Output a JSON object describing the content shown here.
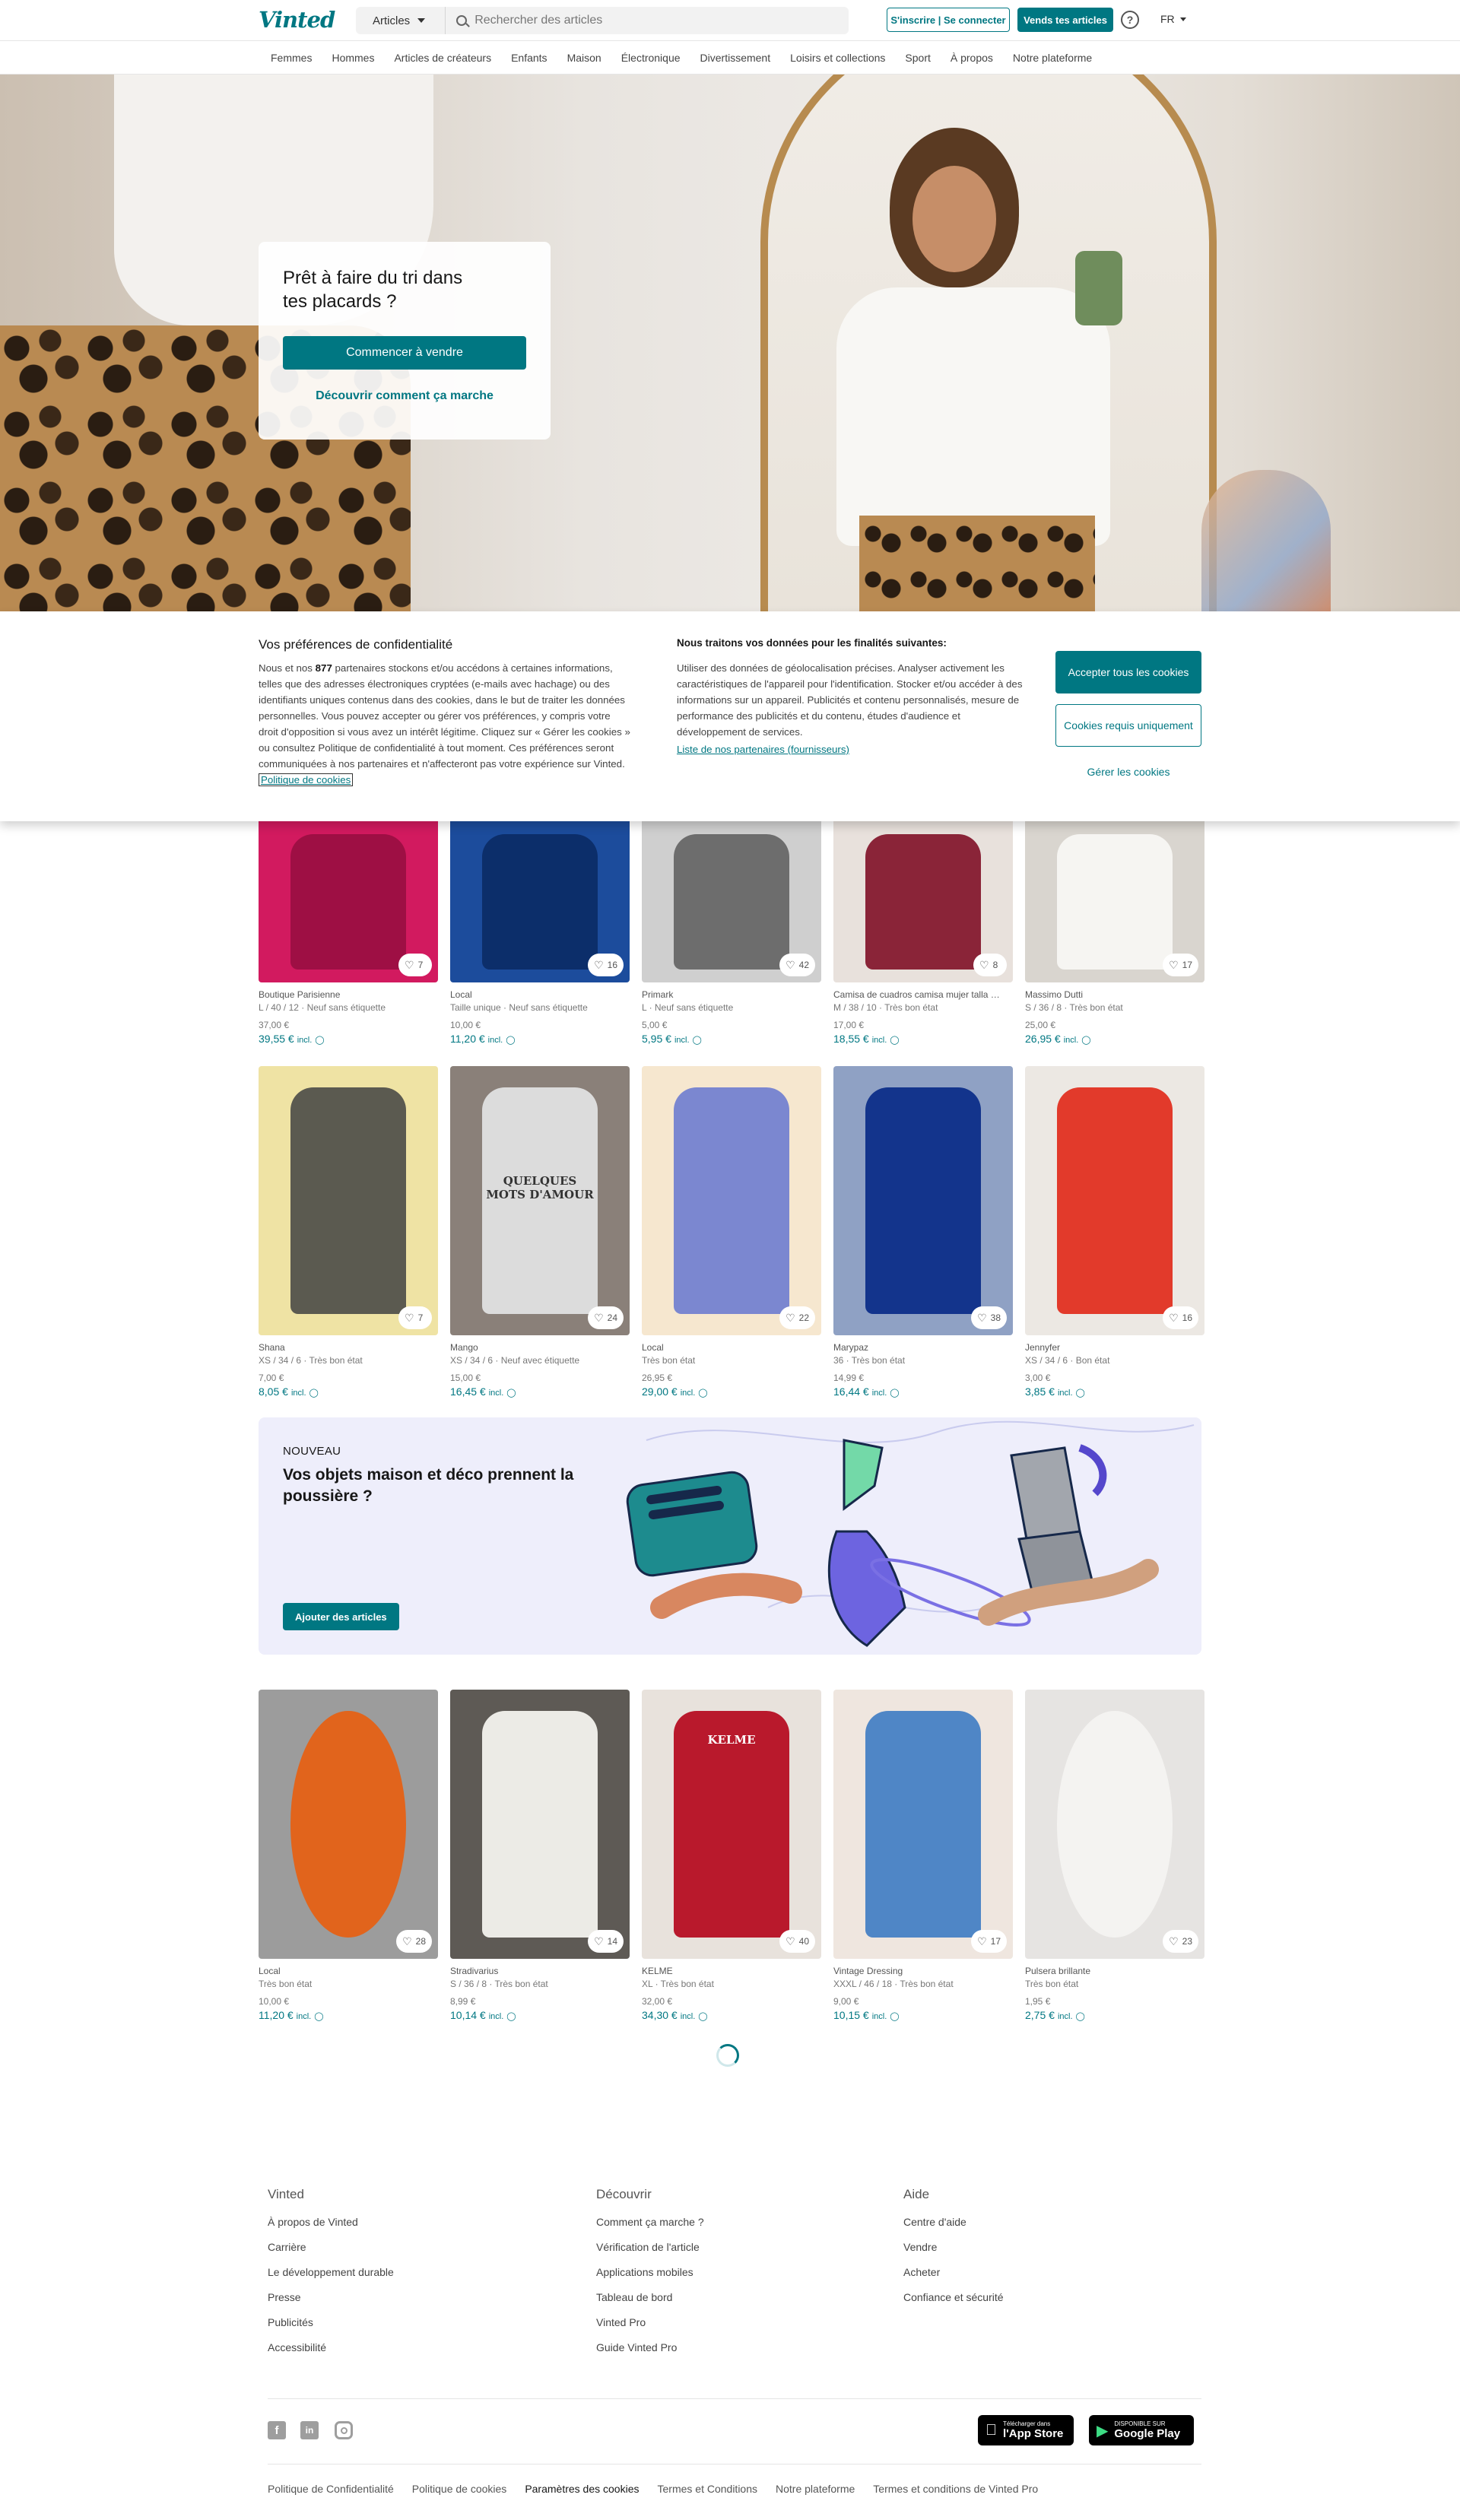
{
  "brand": {
    "logo": "Vinted",
    "accent": "#007782"
  },
  "header": {
    "category_select": "Articles",
    "search_placeholder": "Rechercher des articles",
    "signup_login": "S'inscrire | Se connecter",
    "sell_button": "Vends tes articles",
    "help_icon": "?",
    "language": "FR"
  },
  "catnav": [
    "Femmes",
    "Hommes",
    "Articles de créateurs",
    "Enfants",
    "Maison",
    "Électronique",
    "Divertissement",
    "Loisirs et collections",
    "Sport",
    "À propos",
    "Notre plateforme"
  ],
  "hero": {
    "title": "Prêt à faire du tri dans tes placards ?",
    "cta": "Commencer à vendre",
    "link": "Découvrir comment ça marche"
  },
  "cookie": {
    "title": "Vos préférences de confidentialité",
    "text_before": "Nous et nos ",
    "partner_count": "877",
    "text_after": " partenaires stockons et/ou accédons à certaines informations, telles que des adresses électroniques cryptées (e-mails avec hachage) ou des identifiants uniques contenus dans des cookies, dans le but de traiter les données personnelles. Vous pouvez accepter ou gérer vos préférences, y compris votre droit d'opposition si vous avez un intérêt légitime. Cliquez sur « Gérer les cookies » ou consultez Politique de confidentialité à tout moment. Ces préférences seront communiquées à nos partenaires et n'affecteront pas votre expérience sur Vinted. ",
    "policy_link": "Politique de cookies",
    "purposes_title": "Nous traitons vos données pour les finalités suivantes:",
    "purposes_text": "Utiliser des données de géolocalisation précises. Analyser activement les caractéristiques de l'appareil pour l'identification. Stocker et/ou accéder à des informations sur un appareil. Publicités et contenu personnalisés, mesure de performance des publicités et du contenu, études d'audience et développement de services.",
    "partners_link": "Liste de nos partenaires (fournisseurs)",
    "accept": "Accepter tous les cookies",
    "required": "Cookies requis uniquement",
    "manage": "Gérer les cookies"
  },
  "rows": [
    [
      {
        "brand": "Boutique Parisienne",
        "meta": "L / 40 / 12 · Neuf sans étiquette",
        "price": "37,00 €",
        "total": "39,55 €",
        "incl": "incl.",
        "likes": "7",
        "bg": "#d21a5f",
        "fg": "#9e0f44"
      },
      {
        "brand": "Local",
        "meta": "Taille unique · Neuf sans étiquette",
        "price": "10,00 €",
        "total": "11,20 €",
        "incl": "incl.",
        "likes": "16",
        "bg": "#1c4c9c",
        "fg": "#0c2e6a"
      },
      {
        "brand": "Primark",
        "meta": "L · Neuf sans étiquette",
        "price": "5,00 €",
        "total": "5,95 €",
        "incl": "incl.",
        "likes": "42",
        "bg": "#cfcfcf",
        "fg": "#6d6d6d"
      },
      {
        "brand": "Camisa de cuadros camisa mujer talla …",
        "meta": "M / 38 / 10 · Très bon état",
        "price": "17,00 €",
        "total": "18,55 €",
        "incl": "incl.",
        "likes": "8",
        "bg": "#e8e1dc",
        "fg": "#8a2438"
      },
      {
        "brand": "Massimo Dutti",
        "meta": "S / 36 / 8 · Très bon état",
        "price": "25,00 €",
        "total": "26,95 €",
        "incl": "incl.",
        "likes": "17",
        "bg": "#d9d5cf",
        "fg": "#f6f5f2"
      }
    ],
    [
      {
        "brand": "Shana",
        "meta": "XS / 34 / 6 · Très bon état",
        "price": "7,00 €",
        "total": "8,05 €",
        "incl": "incl.",
        "likes": "7",
        "bg": "#efe3a4",
        "fg": "#5b5a50",
        "caption": ""
      },
      {
        "brand": "Mango",
        "meta": "XS / 34 / 6 · Neuf avec étiquette",
        "price": "15,00 €",
        "total": "16,45 €",
        "incl": "incl.",
        "likes": "24",
        "bg": "#8a8079",
        "fg": "#dcdcdc",
        "caption": "QUELQUES MOTS D'AMOUR"
      },
      {
        "brand": "Local",
        "meta": "Très bon état",
        "price": "26,95 €",
        "total": "29,00 €",
        "incl": "incl.",
        "likes": "22",
        "bg": "#f6e7cf",
        "fg": "#7b87d0",
        "caption": ""
      },
      {
        "brand": "Marypaz",
        "meta": "36 · Très bon état",
        "price": "14,99 €",
        "total": "16,44 €",
        "incl": "incl.",
        "likes": "38",
        "bg": "#8fa1c4",
        "fg": "#13348c",
        "caption": ""
      },
      {
        "brand": "Jennyfer",
        "meta": "XS / 34 / 6 · Bon état",
        "price": "3,00 €",
        "total": "3,85 €",
        "incl": "incl.",
        "likes": "16",
        "bg": "#ece8e3",
        "fg": "#e23a2b",
        "caption": ""
      }
    ],
    [
      {
        "brand": "Local",
        "meta": "Très bon état",
        "price": "10,00 €",
        "total": "11,20 €",
        "incl": "incl.",
        "likes": "28",
        "bg": "#9c9c9c",
        "fg": "#e1641c",
        "caption": ""
      },
      {
        "brand": "Stradivarius",
        "meta": "S / 36 / 8 · Très bon état",
        "price": "8,99 €",
        "total": "10,14 €",
        "incl": "incl.",
        "likes": "14",
        "bg": "#5e5a55",
        "fg": "#ecebe6",
        "caption": ""
      },
      {
        "brand": "KELME",
        "meta": "XL · Très bon état",
        "price": "32,00 €",
        "total": "34,30 €",
        "incl": "incl.",
        "likes": "40",
        "bg": "#e8e2dc",
        "fg": "#b9192c",
        "caption": "KELME"
      },
      {
        "brand": "Vintage Dressing",
        "meta": "XXXL / 46 / 18 · Très bon état",
        "price": "9,00 €",
        "total": "10,15 €",
        "incl": "incl.",
        "likes": "17",
        "bg": "#efe6df",
        "fg": "#4f86c6",
        "caption": ""
      },
      {
        "brand": "Pulsera brillante",
        "meta": "Très bon état",
        "price": "1,95 €",
        "total": "2,75 €",
        "incl": "incl.",
        "likes": "23",
        "bg": "#e6e4e2",
        "fg": "#f4f3f1",
        "caption": ""
      }
    ]
  ],
  "promo": {
    "tag": "NOUVEAU",
    "title": "Vos objets maison et déco prennent la poussière ?",
    "button": "Ajouter des articles"
  },
  "footer": {
    "cols": [
      {
        "title": "Vinted",
        "links": [
          "À propos de Vinted",
          "Carrière",
          "Le développement durable",
          "Presse",
          "Publicités",
          "Accessibilité"
        ]
      },
      {
        "title": "Découvrir",
        "links": [
          "Comment ça marche ?",
          "Vérification de l'article",
          "Applications mobiles",
          "Tableau de bord",
          "Vinted Pro",
          "Guide Vinted Pro"
        ]
      },
      {
        "title": "Aide",
        "links": [
          "Centre d'aide",
          "Vendre",
          "Acheter",
          "Confiance et sécurité"
        ]
      }
    ],
    "appstore": {
      "small": "Télécharger dans",
      "big": "l'App Store"
    },
    "playstore": {
      "small": "DISPONIBLE SUR",
      "big": "Google Play"
    },
    "legal": [
      "Politique de Confidentialité",
      "Politique de cookies",
      "Paramètres des cookies",
      "Termes et Conditions",
      "Notre plateforme",
      "Termes et conditions de Vinted Pro"
    ]
  }
}
